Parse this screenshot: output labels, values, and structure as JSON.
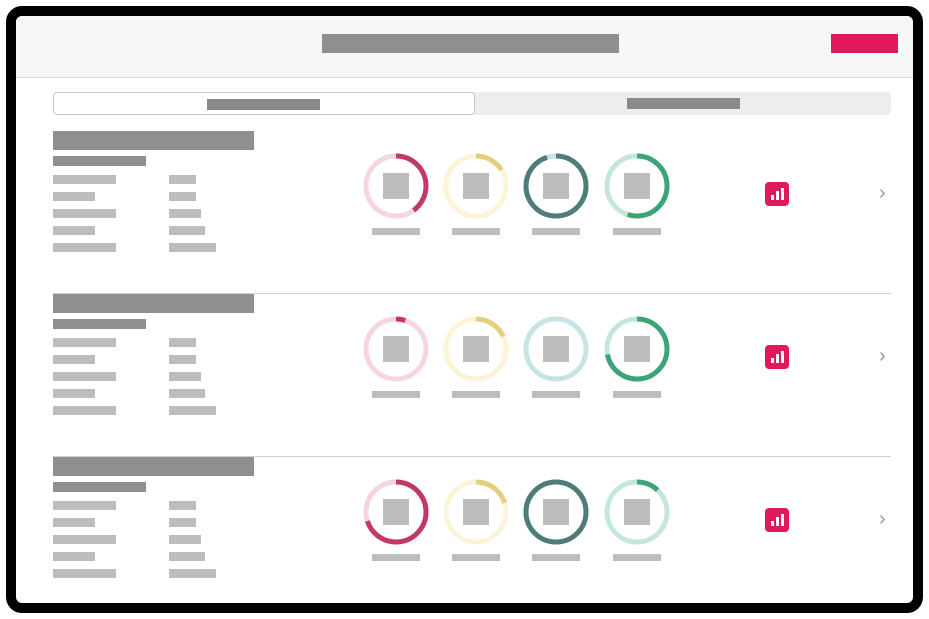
{
  "header": {
    "title_placeholder": "title-block",
    "action_button_color": "#e0195d"
  },
  "tabs": [
    {
      "state": "selected"
    },
    {
      "state": "unselected"
    }
  ],
  "colors": {
    "pink": "#c2386a",
    "pink_track": "#f5d5df",
    "yellow": "#e3cf7e",
    "yellow_track": "#fbf4d7",
    "teal": "#4d7c79",
    "teal_track": "#c7e3e4",
    "green": "#3da477",
    "green_track": "#c4e7d8",
    "accent": "#e0195d"
  },
  "rows": [
    {
      "gauges": [
        0.4,
        0.16,
        0.95,
        0.55
      ]
    },
    {
      "gauges": [
        0.05,
        0.18,
        0.0,
        0.72
      ]
    },
    {
      "gauges": [
        0.7,
        0.2,
        1.0,
        0.12
      ]
    }
  ],
  "icons": {
    "chart": "bar-chart-icon",
    "chevron": "chevron-right-icon"
  },
  "chevron_glyph": "›"
}
